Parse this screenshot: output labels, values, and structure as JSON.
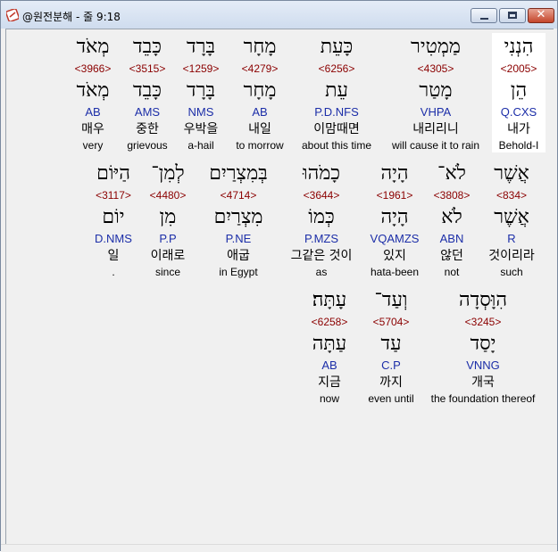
{
  "window": {
    "title": "@원전분해 - 줄 9:18",
    "minimize_label": "",
    "maximize_label": "",
    "close_label": "✕"
  },
  "rows": [
    {
      "words": [
        {
          "hebrew": "מְאֹד",
          "strong": "<3966>",
          "root": "מְאֹד",
          "code": "AB",
          "korean": "매우",
          "english": "very"
        },
        {
          "hebrew": "כָּבֵד",
          "strong": "<3515>",
          "root": "כָּבֵד",
          "code": "AMS",
          "korean": "중한",
          "english": "grievous"
        },
        {
          "hebrew": "בָּרָד",
          "strong": "<1259>",
          "root": "בָּרָד",
          "code": "NMS",
          "korean": "우박을",
          "english": "a-hail"
        },
        {
          "hebrew": "מָחָר",
          "strong": "<4279>",
          "root": "מָחָר",
          "code": "AB",
          "korean": "내일",
          "english": "to morrow"
        },
        {
          "hebrew": "כָּעֵת",
          "strong": "<6256>",
          "root": "עֵת",
          "code": "P.D.NFS",
          "korean": "이맘때면",
          "english": "about this time"
        },
        {
          "hebrew": "מַמְטִיר",
          "strong": "<4305>",
          "root": "מָטַר",
          "code": "VHPA",
          "korean": "내리리니",
          "english": "will cause it to rain"
        },
        {
          "hebrew": "הִנְנִי",
          "strong": "<2005>",
          "root": "הֵן",
          "code": "Q.CXS",
          "korean": "내가",
          "english": "Behold-I"
        }
      ]
    },
    {
      "words": [
        {
          "hebrew": "הַיּוֹם",
          "strong": "<3117>",
          "root": "יוֹם",
          "code": "D.NMS",
          "korean": "일",
          "english": "."
        },
        {
          "hebrew": "לְמִן־",
          "strong": "<4480>",
          "root": "מִן",
          "code": "P.P",
          "korean": "이래로",
          "english": "since"
        },
        {
          "hebrew": "בְּמִצְרַיִם",
          "strong": "<4714>",
          "root": "מִצְרַיִם",
          "code": "P.NE",
          "korean": "애굽",
          "english": "in Egypt"
        },
        {
          "hebrew": "כָמֹהוּ",
          "strong": "<3644>",
          "root": "כְּמוֹ",
          "code": "P.MZS",
          "korean": "그같은 것이",
          "english": "as"
        },
        {
          "hebrew": "הָיָה",
          "strong": "<1961>",
          "root": "הָיָה",
          "code": "VQAMZS",
          "korean": "있지",
          "english": "hata-been"
        },
        {
          "hebrew": "לֹא־",
          "strong": "<3808>",
          "root": "לֹא",
          "code": "ABN",
          "korean": "않던",
          "english": "not"
        },
        {
          "hebrew": "אֲשֶׁר",
          "strong": "<834>",
          "root": "אֲשֶׁר",
          "code": "R",
          "korean": "것이리라",
          "english": "such"
        }
      ]
    },
    {
      "words": [
        {
          "hebrew": "עָתָּה׃",
          "strong": "<6258>",
          "root": "עַתָּה",
          "code": "AB",
          "korean": "지금",
          "english": "now"
        },
        {
          "hebrew": "וְעַד־",
          "strong": "<5704>",
          "root": "עַד",
          "code": "C.P",
          "korean": "까지",
          "english": "even until"
        },
        {
          "hebrew": "הִוָּסְדָה",
          "strong": "<3245>",
          "root": "יָסַד",
          "code": "VNNG",
          "korean": "개국",
          "english": "the foundation thereof"
        }
      ]
    }
  ]
}
